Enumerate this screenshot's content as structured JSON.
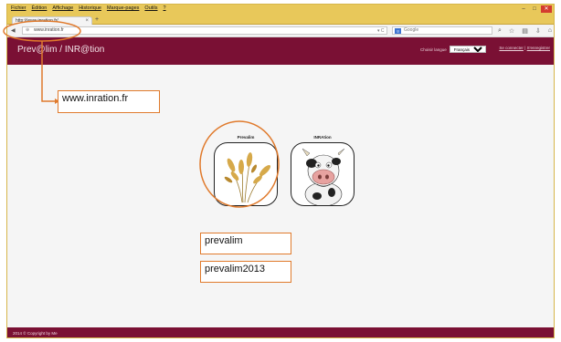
{
  "browser": {
    "menu": [
      "Fichier",
      "Édition",
      "Affichage",
      "Historique",
      "Marque-pages",
      "Outils",
      "?"
    ],
    "tab_title": "http://www.inration.fr/",
    "address": "www.inration.fr",
    "search_placeholder": "Google"
  },
  "site": {
    "brand": "Prev@lim / INR@tion",
    "language_label": "Choisir langue",
    "language_value": "Français",
    "login_text": "Se connecter",
    "separator": "|",
    "register_text": "S'enregistrer",
    "apps": [
      {
        "label": "Prevalim"
      },
      {
        "label": "INRAtion"
      }
    ],
    "footer": "2014 © Copyright by Me"
  },
  "annotations": {
    "url": "www.inration.fr",
    "username": "prevalim",
    "password": "prevalim2013"
  },
  "colors": {
    "brand": "#7a1034",
    "accent": "#e07a2c",
    "chrome": "#e8c85a"
  }
}
